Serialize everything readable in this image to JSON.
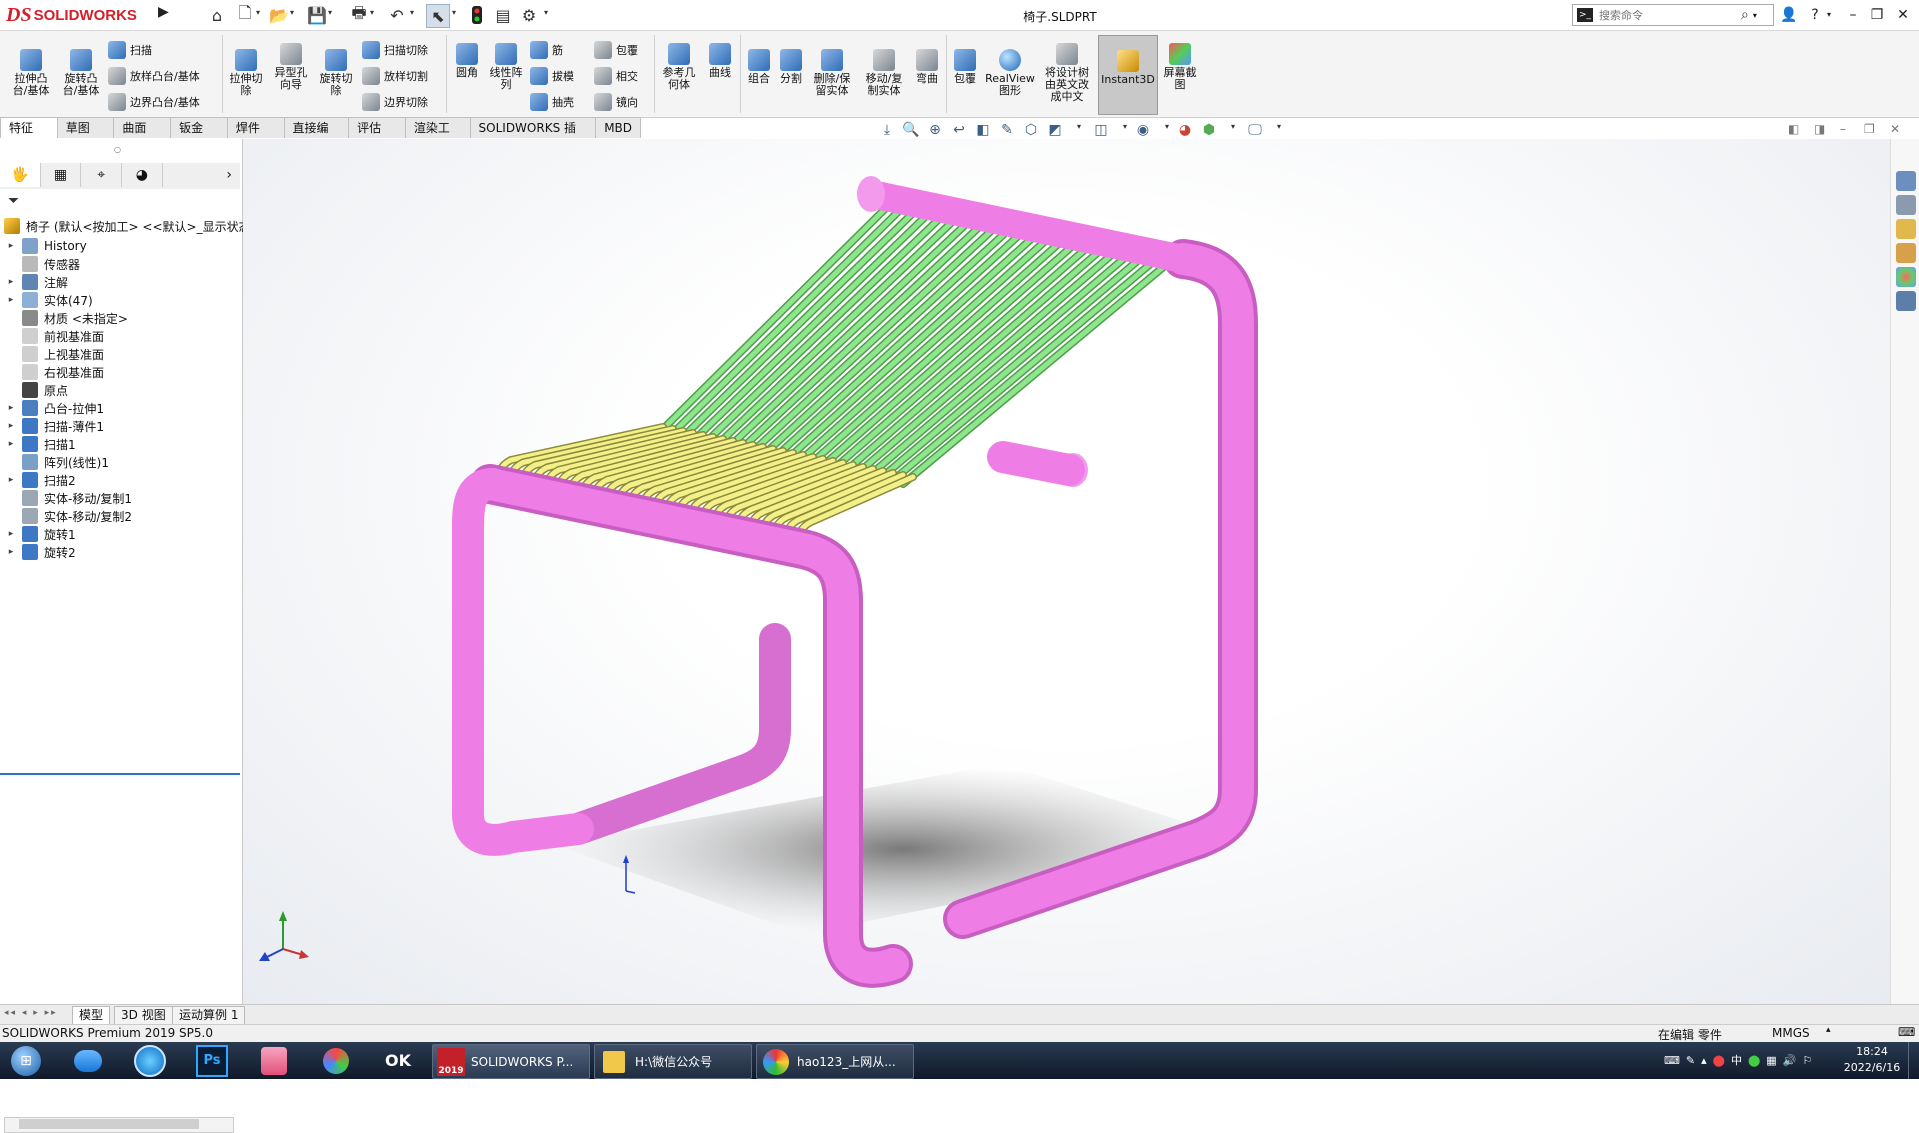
{
  "app": {
    "brand_ds": "DS",
    "brand_name": "SOLIDWORKS",
    "document_title": "椅子.SLDPRT"
  },
  "search": {
    "placeholder": "搜索命令"
  },
  "window_controls": {
    "help": "?",
    "minimize": "–",
    "restore": "❐",
    "close": "✕"
  },
  "ribbon": {
    "tools": {
      "extrude_boss": "拉伸凸\n台/基体",
      "revolve_boss": "旋转凸\n台/基体",
      "sweep": "扫描",
      "loft_boss": "放样凸台/基体",
      "boundary_boss": "边界凸台/基体",
      "extrude_cut": "拉伸切\n除",
      "hole_wizard": "异型孔\n向导",
      "revolve_cut": "旋转切\n除",
      "sweep_cut": "扫描切除",
      "loft_cut": "放样切割",
      "boundary_cut": "边界切除",
      "fillet": "圆角",
      "linear_pattern": "线性阵\n列",
      "rib": "筋",
      "draft": "拔模",
      "shell": "抽壳",
      "wrap": "包覆",
      "intersect": "相交",
      "mirror": "镜向",
      "ref_geometry": "参考几\n何体",
      "curves": "曲线",
      "combine": "组合",
      "split": "分割",
      "delete_keep_body": "删除/保\n留实体",
      "move_copy_body": "移动/复\n制实体",
      "flex": "弯曲",
      "wrap2": "包覆",
      "realview": "RealView\n图形",
      "translate_tree": "将设计树\n由英文改\n成中文",
      "instant3d": "Instant3D",
      "screen_capture": "屏幕截\n图"
    }
  },
  "tabs": [
    "特征",
    "草图",
    "曲面",
    "钣金",
    "焊件",
    "直接编辑",
    "评估",
    "渲染工具",
    "SOLIDWORKS 插件",
    "MBD"
  ],
  "feature_tree": {
    "root": "椅子  (默认<按加工> <<默认>_显示状态",
    "items": [
      {
        "label": "History",
        "expandable": true
      },
      {
        "label": "传感器",
        "expandable": false
      },
      {
        "label": "注解",
        "expandable": true
      },
      {
        "label": "实体(47)",
        "expandable": true
      },
      {
        "label": "材质 <未指定>",
        "expandable": false
      },
      {
        "label": "前视基准面",
        "expandable": false
      },
      {
        "label": "上视基准面",
        "expandable": false
      },
      {
        "label": "右视基准面",
        "expandable": false
      },
      {
        "label": "原点",
        "expandable": false
      },
      {
        "label": "凸台-拉伸1",
        "expandable": true
      },
      {
        "label": "扫描-薄件1",
        "expandable": true
      },
      {
        "label": "扫描1",
        "expandable": true
      },
      {
        "label": "阵列(线性)1",
        "expandable": false
      },
      {
        "label": "扫描2",
        "expandable": true
      },
      {
        "label": "实体-移动/复制1",
        "expandable": false
      },
      {
        "label": "实体-移动/复制2",
        "expandable": false
      },
      {
        "label": "旋转1",
        "expandable": true
      },
      {
        "label": "旋转2",
        "expandable": true
      }
    ]
  },
  "bottom_tabs": [
    "模型",
    "3D 视图",
    "运动算例 1"
  ],
  "status": {
    "product": "SOLIDWORKS Premium 2019 SP5.0",
    "mode": "在编辑 零件",
    "units": "MMGS"
  },
  "taskbar": {
    "apps": [
      {
        "label": "SOLIDWORKS P..."
      },
      {
        "label": "H:\\微信公众号"
      },
      {
        "label": "hao123_上网从..."
      }
    ],
    "sw_year": "2019",
    "ps_label": "Ps",
    "ok_label": "OK",
    "time": "18:24",
    "date": "2022/6/16"
  },
  "colors": {
    "frame": "#ee7ee6",
    "seat_slats": "#f3f08a",
    "back_slats": "#8ee68c",
    "brand_red": "#d3202a",
    "tree_accent": "#2b74c5"
  }
}
